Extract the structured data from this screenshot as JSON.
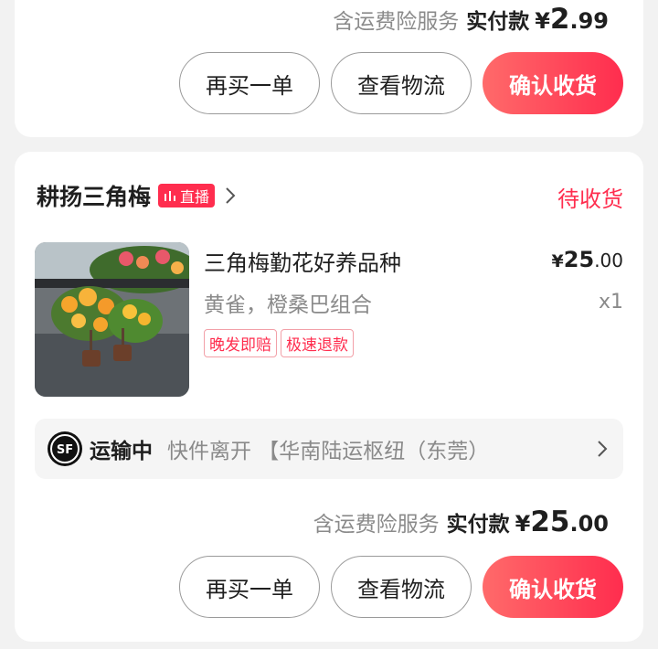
{
  "order_top": {
    "service_label": "含运费险服务",
    "paid_label": "实付款",
    "currency": "¥",
    "amount_int": "2",
    "amount_dec": ".99",
    "buttons": {
      "rebuy": "再买一单",
      "logistics": "查看物流",
      "confirm": "确认收货"
    }
  },
  "order_main": {
    "shop_name": "耕扬三角梅",
    "live_badge": "直播",
    "status": "待收货",
    "product": {
      "title": "三角梅勤花好养品种",
      "variant": "黄雀，橙桑巴组合",
      "tags": [
        "晚发即赔",
        "极速退款"
      ],
      "currency": "¥",
      "price_int": "25",
      "price_dec": ".00",
      "quantity": "x1"
    },
    "logistics": {
      "carrier_logo_text": "SF",
      "status": "运输中",
      "detail": "快件离开 【华南陆运枢纽（东莞）"
    },
    "total": {
      "service_label": "含运费险服务",
      "paid_label": "实付款",
      "currency": "¥",
      "amount_int": "25",
      "amount_dec": ".00"
    },
    "buttons": {
      "rebuy": "再买一单",
      "logistics": "查看物流",
      "confirm": "确认收货"
    }
  },
  "colors": {
    "accent": "#ff2d4e",
    "gray_text": "#8a8a8a",
    "background": "#f2f2f2"
  },
  "icons": [
    "live-bars-icon",
    "chevron-right-icon",
    "sf-express-logo"
  ]
}
